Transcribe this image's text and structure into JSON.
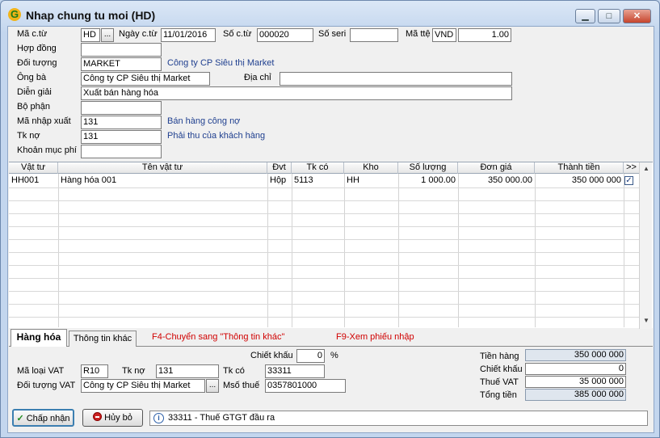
{
  "window": {
    "title": "Nhap chung tu moi (HD)",
    "logo": "G",
    "min": "▁",
    "max": "□",
    "close": "✕"
  },
  "header": {
    "ma_ct_label": "Mã c.từ",
    "ma_ct": "HD",
    "browse": "...",
    "ngay_ct_label": "Ngày c.từ",
    "ngay_ct": "11/01/2016",
    "so_ct_label": "Số c.từ",
    "so_ct": "000020",
    "so_seri_label": "Số seri",
    "so_seri": "",
    "ma_tte_label": "Mã ttệ",
    "ma_tte": "VND",
    "ty_gia": "1.00",
    "hop_dong_label": "Hợp đồng",
    "hop_dong": "",
    "doi_tuong_label": "Đối tượng",
    "doi_tuong": "MARKET",
    "doi_tuong_desc": "Công ty CP Siêu thị Market",
    "ong_ba_label": "Ông bà",
    "ong_ba": "Công ty CP Siêu thị Market",
    "dia_chi_label": "Địa chỉ",
    "dia_chi": "",
    "dien_giai_label": "Diễn giải",
    "dien_giai": "Xuất bán hàng hóa",
    "bo_phan_label": "Bộ phận",
    "bo_phan": "",
    "ma_nx_label": "Mã nhập xuất",
    "ma_nx": "131",
    "ma_nx_desc": "Bán hàng công nợ",
    "tk_no_label": "Tk nợ",
    "tk_no": "131",
    "tk_no_desc": "Phải thu của khách hàng",
    "khoan_muc_label": "Khoản mục phí",
    "khoan_muc": ""
  },
  "grid": {
    "columns": [
      "Vật tư",
      "Tên vật tư",
      "Đvt",
      "Tk có",
      "Kho",
      "Số lượng",
      "Đơn giá",
      "Thành tiền",
      ">>"
    ],
    "rows": [
      {
        "vat_tu": "HH001",
        "ten": "Hàng hóa 001",
        "dvt": "Hộp",
        "tk_co": "5113",
        "kho": "HH",
        "so_luong": "1 000.00",
        "don_gia": "350 000.00",
        "thanh_tien": "350 000 000",
        "checked": "✓"
      }
    ],
    "scroll_up": "▲",
    "scroll_down": "▼"
  },
  "tabs": {
    "hang_hoa": "Hàng hóa",
    "thong_tin_khac": "Thông tin khác"
  },
  "hints": {
    "f4": "F4-Chuyển sang \"Thông tin khác\"",
    "f9": "F9-Xem phiếu nhập"
  },
  "footer": {
    "chiet_khau_label": "Chiết khấu",
    "chiet_khau_pct": "0",
    "pct": "%",
    "ma_loai_vat_label": "Mã loại VAT",
    "ma_loai_vat": "R10",
    "tk_no_label": "Tk nợ",
    "tk_no": "131",
    "tk_co_label": "Tk có",
    "tk_co": "33311",
    "doi_tuong_vat_label": "Đối tượng VAT",
    "doi_tuong_vat": "Công ty CP Siêu thị Market",
    "mso_thue_label": "Msố thuế",
    "mso_thue": "0357801000"
  },
  "totals": {
    "tien_hang_label": "Tiền hàng",
    "tien_hang": "350 000 000",
    "chiet_khau_label": "Chiết khấu",
    "chiet_khau": "0",
    "thue_vat_label": "Thuế VAT",
    "thue_vat": "35 000 000",
    "tong_tien_label": "Tổng tiền",
    "tong_tien": "385 000 000"
  },
  "buttons": {
    "ok_icon": "✓",
    "ok": "Chấp nhận",
    "cancel": "Hủy bỏ"
  },
  "status": {
    "info_icon": "i",
    "text": "33311 - Thuế GTGT đầu ra"
  }
}
